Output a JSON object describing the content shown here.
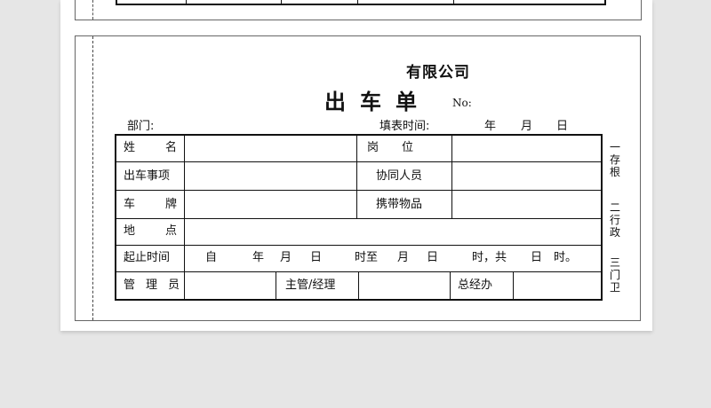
{
  "form": {
    "company": "有限公司",
    "title": "出车单",
    "no_label": "No:",
    "dept_label": "部门:",
    "fill_time_label": "填表时间:",
    "date_year": "年",
    "date_month": "月",
    "date_day": "日"
  },
  "table": {
    "name_label": "姓名",
    "position_label": "岗位",
    "purpose_label": "出车事项",
    "companion_label": "协同人员",
    "plate_label": "车牌",
    "items_label": "携带物品",
    "location_label": "地点",
    "period_label": "起止时间",
    "period_from": "自",
    "period_year": "年",
    "period_month": "月",
    "period_day": "日",
    "period_hour_to": "时至",
    "period_month2": "月",
    "period_day2": "日",
    "period_total": "时，共",
    "period_days": "日",
    "period_hours_end": "时。",
    "manager_label": "管理员",
    "supervisor_label": "主管/经理",
    "gm_office_label": "总经办"
  },
  "copies": {
    "first": "一存根",
    "second": "二行政",
    "third": "三门卫"
  }
}
